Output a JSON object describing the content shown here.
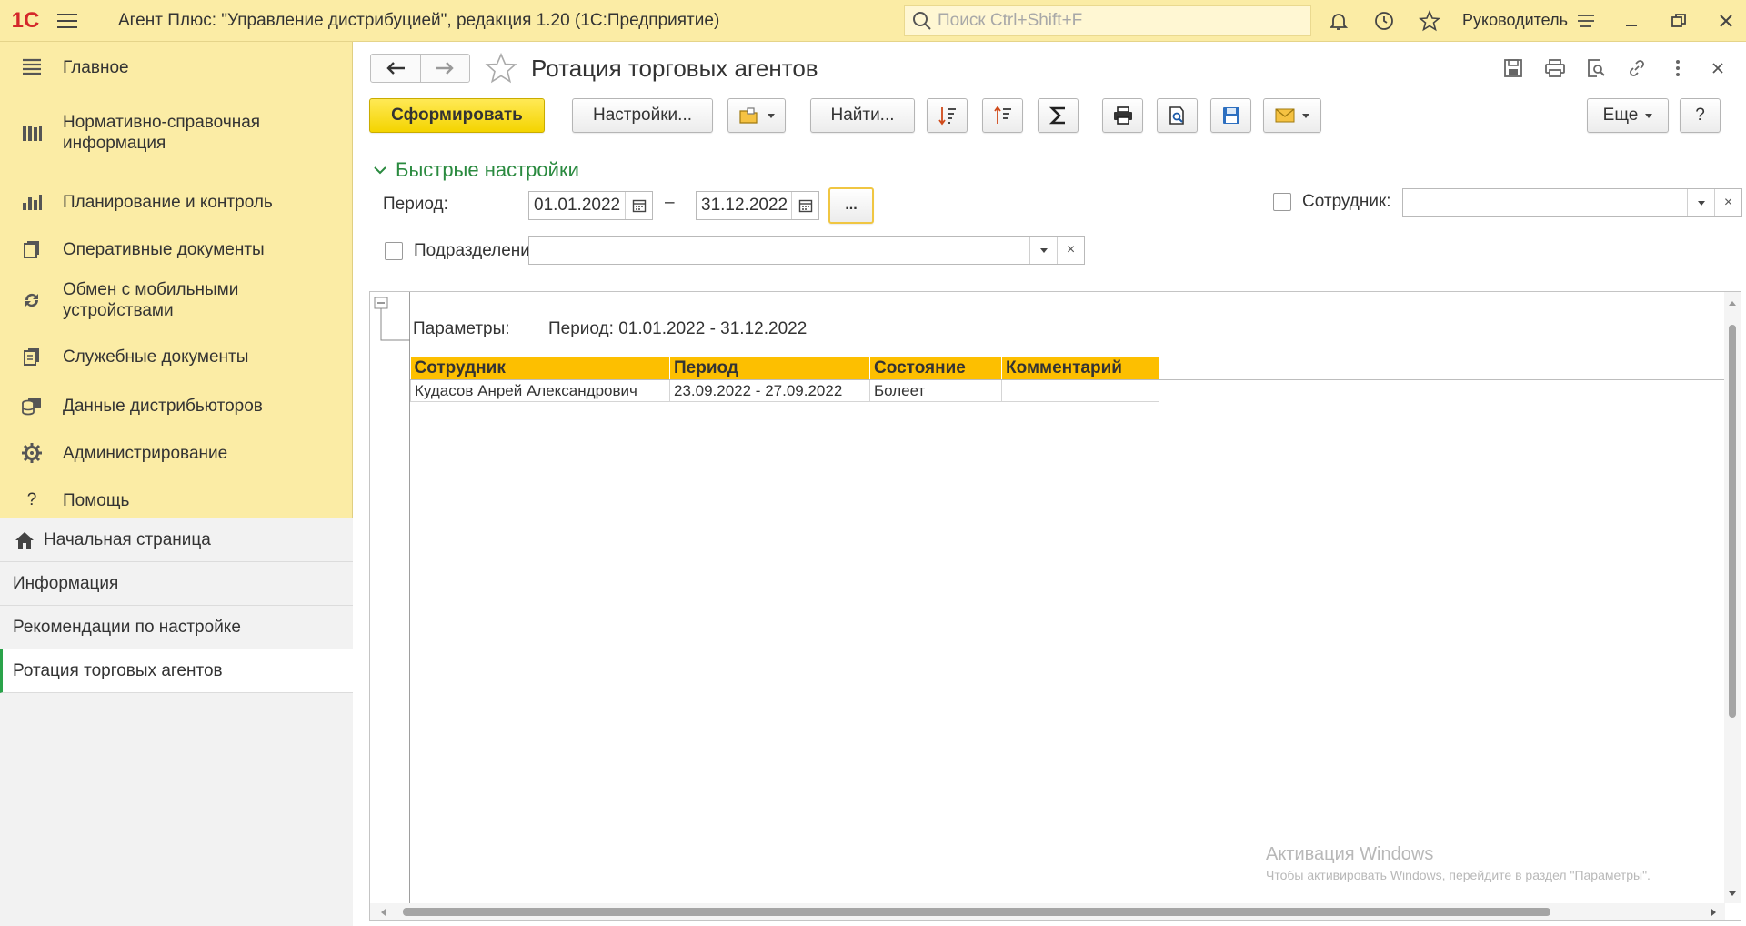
{
  "topbar": {
    "logo_text": "1С",
    "app_title": "Агент Плюс: \"Управление дистрибуцией\", редакция 1.20  (1С:Предприятие)",
    "search_placeholder": "Поиск Ctrl+Shift+F",
    "user": "Руководитель"
  },
  "sidebar": {
    "items": [
      {
        "label": "Главное",
        "icon": "menu-lines-icon"
      },
      {
        "label": "Нормативно-справочная\nинформация",
        "icon": "books-icon"
      },
      {
        "label": "Планирование и контроль",
        "icon": "bar-chart-icon"
      },
      {
        "label": "Оперативные документы",
        "icon": "documents-icon"
      },
      {
        "label": "Обмен с мобильными\nустройствами",
        "icon": "sync-icon"
      },
      {
        "label": "Служебные документы",
        "icon": "clipboard-icon"
      },
      {
        "label": "Данные дистрибьюторов",
        "icon": "database-icon"
      },
      {
        "label": "Администрирование",
        "icon": "gear-icon"
      },
      {
        "label": "Помощь",
        "icon": "question-icon"
      }
    ],
    "open_windows": [
      {
        "label": "Начальная страница"
      },
      {
        "label": "Информация"
      },
      {
        "label": "Рекомендации по настройке"
      },
      {
        "label": "Ротация торговых агентов"
      }
    ]
  },
  "form": {
    "title": "Ротация торговых агентов",
    "toolbar": {
      "generate": "Сформировать",
      "settings": "Настройки...",
      "find": "Найти...",
      "more": "Еще",
      "help": "?"
    },
    "quick_settings": {
      "title": "Быстрые настройки",
      "period_label": "Период:",
      "date_from": "01.01.2022",
      "dash": "–",
      "date_to": "31.12.2022",
      "ellipsis": "...",
      "employee_label": "Сотрудник:",
      "employee_value": "",
      "department_label": "Подразделение:",
      "department_value": ""
    }
  },
  "report": {
    "params_label": "Параметры:",
    "params_value": "Период: 01.01.2022 - 31.12.2022",
    "columns": [
      "Сотрудник",
      "Период",
      "Состояние",
      "Комментарий"
    ],
    "rows": [
      [
        "Кудасов Анрей Александрович",
        "23.09.2022 - 27.09.2022",
        "Болеет",
        ""
      ]
    ]
  },
  "watermark": {
    "line1": "Активация Windows",
    "line2": "Чтобы активировать Windows, перейдите в раздел \"Параметры\"."
  },
  "colors": {
    "topbar_bg": "#fbeca5",
    "accent_green": "#2a8a3f",
    "primary_button": "#f4d400",
    "table_header": "#fdbf00"
  }
}
